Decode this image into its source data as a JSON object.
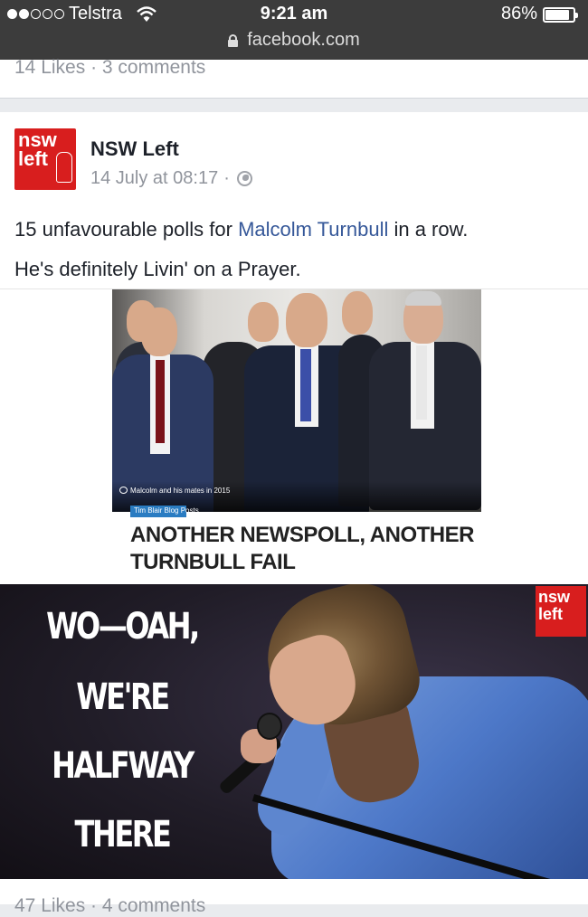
{
  "status_bar": {
    "carrier": "Telstra",
    "time": "9:21 am",
    "battery_percent": "86%",
    "battery_level": 0.86,
    "url": "facebook.com"
  },
  "previous_post": {
    "likes": "14 Likes",
    "separator": "·",
    "comments": "3 comments"
  },
  "post": {
    "page_name": "NSW Left",
    "avatar_line1": "nsw",
    "avatar_line2": "left",
    "timestamp": "14 July at 08:17",
    "meta_separator": "·",
    "text_before_link": "15 unfavourable polls for ",
    "link_text": "Malcolm Turnbull",
    "text_after_link": " in a row.",
    "text_line2": "He's definitely Livin' on a Prayer.",
    "shared_image": {
      "caption": "Malcolm and his mates in 2015",
      "tag": "Tim Blair Blog Posts",
      "headline": "ANOTHER NEWSPOLL, ANOTHER TURNBULL FAIL"
    },
    "meme": {
      "lines": [
        "WO—OAH,",
        "WE'RE",
        "HALFWAY",
        "THERE"
      ],
      "logo_line1": "nsw",
      "logo_line2": "left"
    },
    "footer_stats": "47 Likes · 4 comments"
  },
  "colors": {
    "status_bar_bg": "#3c3c3c",
    "brand_red": "#d81e1e",
    "link_blue": "#365899",
    "meta_gray": "#90949c"
  }
}
